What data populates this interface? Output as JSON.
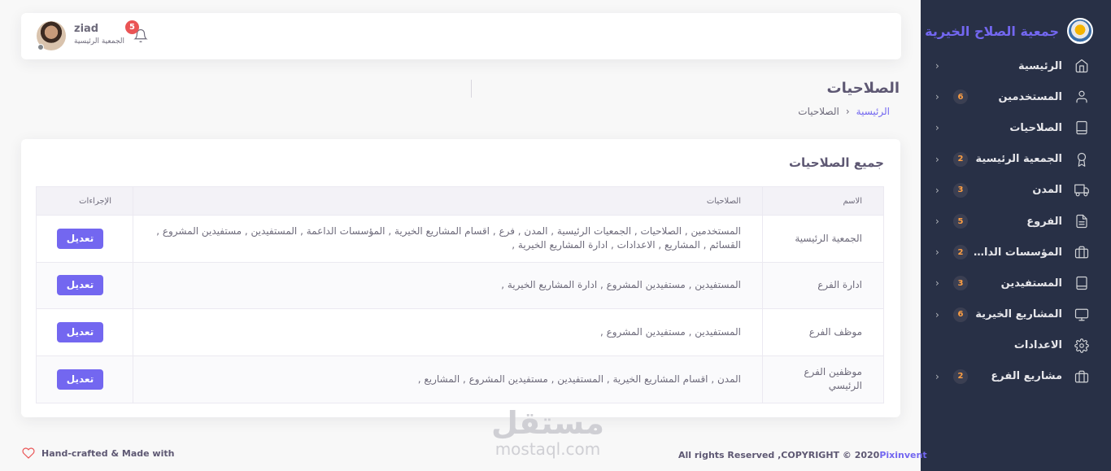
{
  "brand": {
    "name": "جمعية الصلاح الخيرية"
  },
  "sidebar": {
    "items": [
      {
        "label": "الرئيسية",
        "icon": "home-icon",
        "badge": ""
      },
      {
        "label": "المستخدمين",
        "icon": "user-icon",
        "badge": "6"
      },
      {
        "label": "الصلاحيات",
        "icon": "tablet-icon",
        "badge": ""
      },
      {
        "label": "الجمعية الرئيسية",
        "icon": "award-icon",
        "badge": "2"
      },
      {
        "label": "المدن",
        "icon": "truck-icon",
        "badge": "3"
      },
      {
        "label": "الفروع",
        "icon": "file-text-icon",
        "badge": "5"
      },
      {
        "label": "المؤسسات الداعمة",
        "icon": "briefcase-icon",
        "badge": "2"
      },
      {
        "label": "المستفيدين",
        "icon": "tablet-icon",
        "badge": "3"
      },
      {
        "label": "المشاريع الخيرية",
        "icon": "monitor-icon",
        "badge": "6"
      },
      {
        "label": "الاعدادات",
        "icon": "settings-icon",
        "badge": ""
      },
      {
        "label": "مشاريع الفرع",
        "icon": "briefcase-icon",
        "badge": "2"
      }
    ]
  },
  "header": {
    "user_name": "ziad",
    "user_role": "الجمعية الرئيسية",
    "notification_count": "5"
  },
  "page": {
    "title": "الصلاحيات",
    "breadcrumb_home": "الرئيسية",
    "breadcrumb_current": "الصلاحيات"
  },
  "card": {
    "title": "جميع الصلاحيات",
    "columns": {
      "name": "الاسم",
      "permissions": "الصلاحيات",
      "actions": "الإجراءات"
    },
    "rows": [
      {
        "name": "الجمعية الرئيسية",
        "permissions": "المستخدمين , الصلاحيات , الجمعيات الرئيسية , المدن , فرع , اقسام المشاريع الخيرية , المؤسسات الداعمة , المستفيدين , مستفيدين المشروع , القسائم , المشاريع , الاعدادات , ادارة المشاريع الخيرية ,",
        "action": "تعديل"
      },
      {
        "name": "ادارة الفرع",
        "permissions": "المستفيدين , مستفيدين المشروع , ادارة المشاريع الخيرية ,",
        "action": "تعديل"
      },
      {
        "name": "موظف الفرع",
        "permissions": "المستفيدين , مستفيدين المشروع ,",
        "action": "تعديل"
      },
      {
        "name": "موظفين الفرع الرئيسي",
        "permissions": "المدن , اقسام المشاريع الخيرية , المستفيدين , مستفيدين المشروع , المشاريع ,",
        "action": "تعديل"
      }
    ]
  },
  "watermark": {
    "arabic": "مستقل",
    "latin": "mostaql.com"
  },
  "footer": {
    "left_text": "Hand-crafted & Made with",
    "right_text": "All rights Reserved ,COPYRIGHT © 2020",
    "right_link": "Pixinvent"
  },
  "colors": {
    "accent": "#7367f0",
    "sidebar_bg": "#283046",
    "badge_orange": "#ff9f43",
    "danger": "#ea5455"
  }
}
